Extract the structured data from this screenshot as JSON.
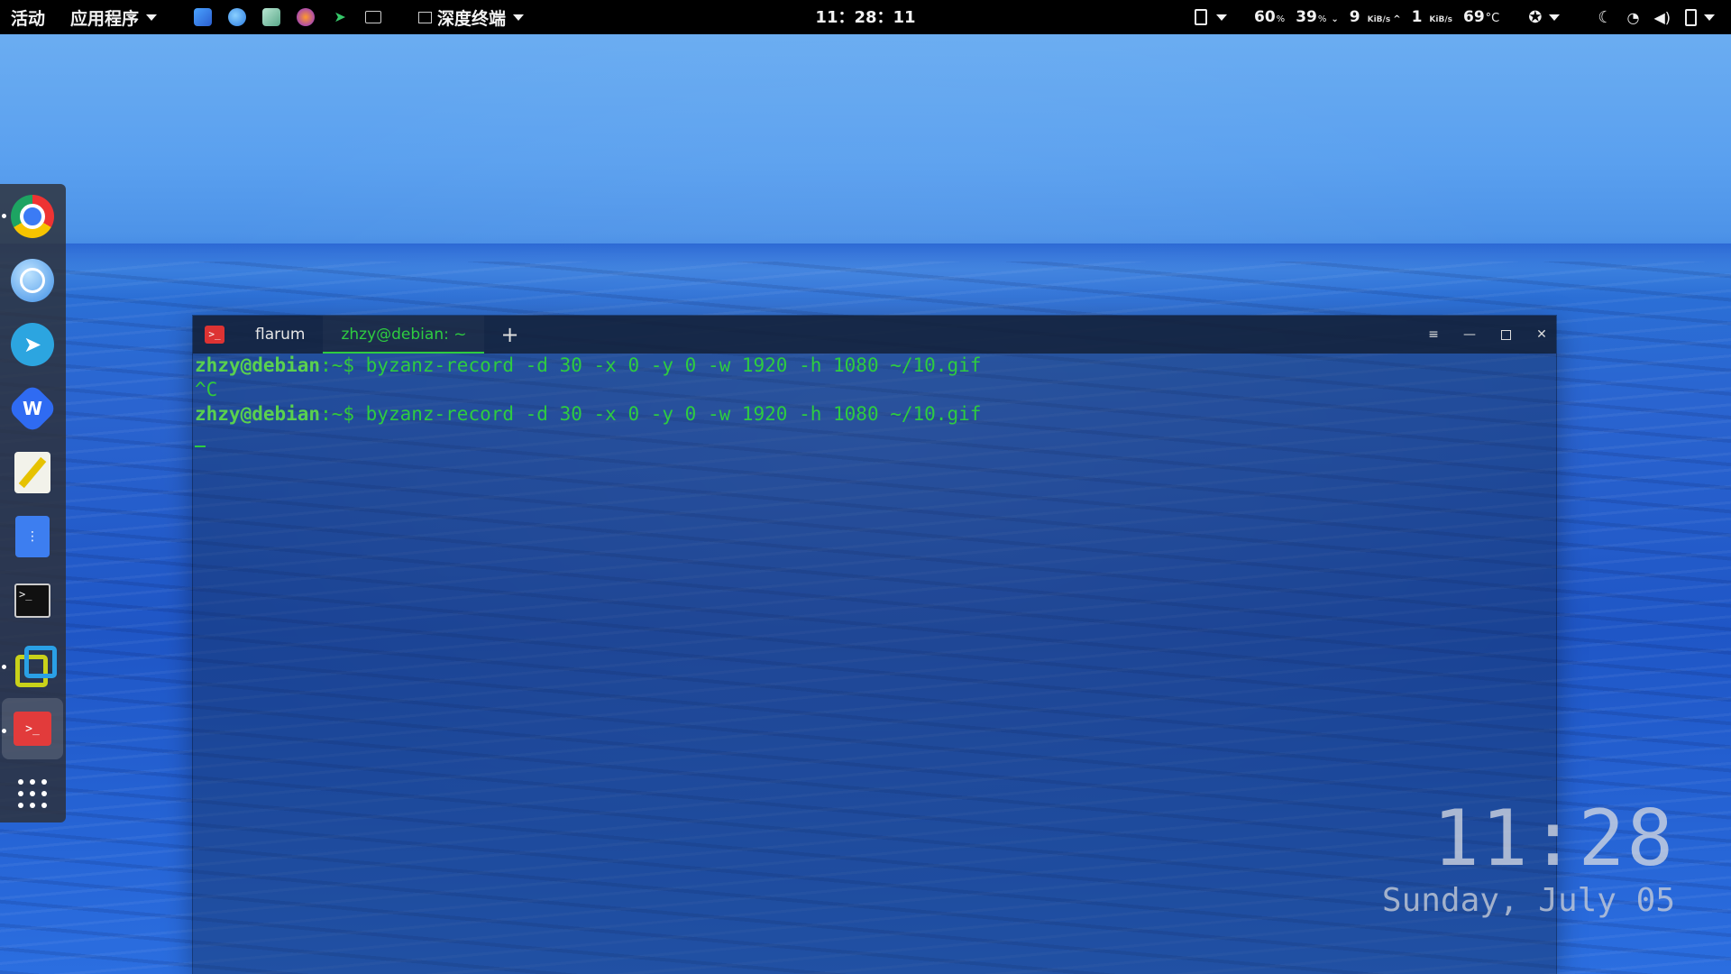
{
  "topbar": {
    "activities": "活动",
    "applications": "应用程序",
    "window_menu": "深度终端",
    "clock": "11：28：11",
    "stats": {
      "cpu": "60",
      "cpu_unit": "%",
      "mem": "39",
      "mem_unit": "%",
      "net_down": "9",
      "net_down_unit": "KiB/s",
      "net_up": "1",
      "net_up_unit": "KiB/s",
      "temp": "69",
      "temp_unit": "°C"
    }
  },
  "tray_icons": [
    "app-store-icon",
    "browser-badge-icon",
    "screenshot-icon",
    "firefox-icon",
    "telegram-icon",
    "keyboard-icon"
  ],
  "dock": {
    "items": [
      "chrome-icon",
      "deepin-browser-icon",
      "telegram-icon",
      "wps-icon",
      "text-editor-icon",
      "file-manager-icon",
      "terminal-icon",
      "virtualbox-icon",
      "deepin-terminal-icon",
      "app-grid-icon"
    ]
  },
  "terminal": {
    "tabs": [
      {
        "label": "flarum",
        "active": false
      },
      {
        "label": "zhzy@debian: ~",
        "active": true
      }
    ],
    "lines": [
      {
        "user": "zhzy@debian",
        "path": ":~$ ",
        "cmd": "byzanz-record -d 30 -x 0 -y 0 -w 1920 -h 1080 ~/10.gif"
      },
      {
        "text": "^C"
      },
      {
        "user": "zhzy@debian",
        "path": ":~$ ",
        "cmd": "byzanz-record -d 30 -x 0 -y 0 -w 1920 -h 1080 ~/10.gif"
      }
    ]
  },
  "desktop_clock": {
    "time": "11:28",
    "date": "Sunday, July 05"
  },
  "colors": {
    "terminal_green": "#2ecc40",
    "panel": "#000000"
  }
}
